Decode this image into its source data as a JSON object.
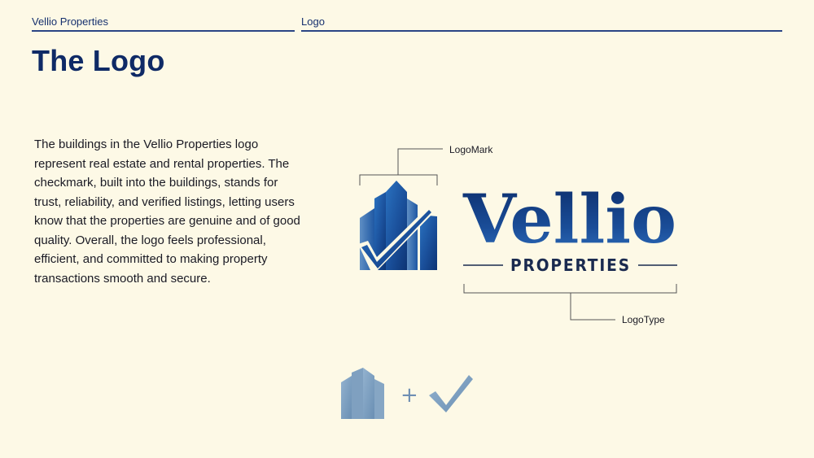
{
  "header": {
    "brand_label": "Vellio Properties",
    "section_label": "Logo"
  },
  "page_title": "The Logo",
  "description": "The buildings in the Vellio Properties logo represent real estate and rental properties. The checkmark, built into the buildings, stands for trust, reliability, and verified listings, letting users know that the properties are genuine and of good quality. Overall, the logo feels professional, efficient, and committed to making property transactions smooth and secure.",
  "logo": {
    "wordmark": "Vellio",
    "subtitle": "PROPERTIES",
    "mark_label": "LogoMark",
    "type_label": "LogoType"
  },
  "breakdown": {
    "plus_sign": "+"
  },
  "colors": {
    "background": "#fdf9e6",
    "primary_navy": "#0f2a66",
    "logo_blue_dark": "#0d3474",
    "logo_blue_light": "#2a72c0",
    "muted_blue": "#7b9dbc"
  }
}
